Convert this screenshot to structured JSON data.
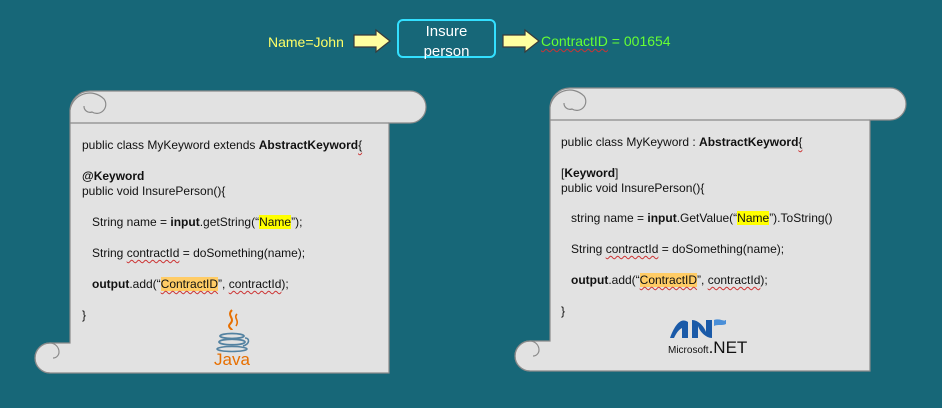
{
  "flow": {
    "input_label": "Name=John",
    "action_label_line1": "Insure",
    "action_label_line2": "person",
    "output_label_key": "ContractID",
    "output_label_rest": " = 001654"
  },
  "java": {
    "l1_a": "public class MyKeyword extends ",
    "l1_b": "AbstractKeyword",
    "l1_c": "{",
    "l2": "@Keyword",
    "l3": "public void InsurePerson(){",
    "l4_a": "String name = ",
    "l4_b": "input",
    "l4_c": ".getString(“",
    "l4_d": "Name",
    "l4_e": "”);",
    "l5_a": "String ",
    "l5_b": "contractId",
    "l5_c": " = doSomething(name);",
    "l6_a": "output",
    "l6_b": ".add(“",
    "l6_c": "ContractID",
    "l6_d": "”, ",
    "l6_e": "contractId",
    "l6_f": ");",
    "l7": "}",
    "logo_text": "Java"
  },
  "dotnet": {
    "l1_a": "public class MyKeyword : ",
    "l1_b": "AbstractKeyword",
    "l1_c": "{",
    "l2_a": "[",
    "l2_b": "Keyword",
    "l2_c": "]",
    "l3": "public void InsurePerson(){",
    "l4_a": "string name = ",
    "l4_b": "input",
    "l4_c": ".GetValue(“",
    "l4_d": "Name",
    "l4_e": "”).ToString()",
    "l5_a": "String ",
    "l5_b": "contractId",
    "l5_c": " = doSomething(name);",
    "l6_a": "output",
    "l6_b": ".add(“",
    "l6_c": "ContractID",
    "l6_d": "”, ",
    "l6_e": "contractId",
    "l6_f": ");",
    "l7": "}",
    "logo_small": "Microsoft",
    "logo_big": ".NET"
  },
  "colors": {
    "background": "#176778",
    "input_text": "#ffff66",
    "output_text": "#66ff33",
    "box_border": "#33e0ff",
    "arrow_fill": "#ffffa0",
    "scroll_fill": "#e2e2e2",
    "highlight_yellow": "#ffff00",
    "highlight_orange": "#ffcc66",
    "java_orange": "#e76f00",
    "java_blue": "#5382a1",
    "dotnet_blue": "#1a5aa8"
  }
}
